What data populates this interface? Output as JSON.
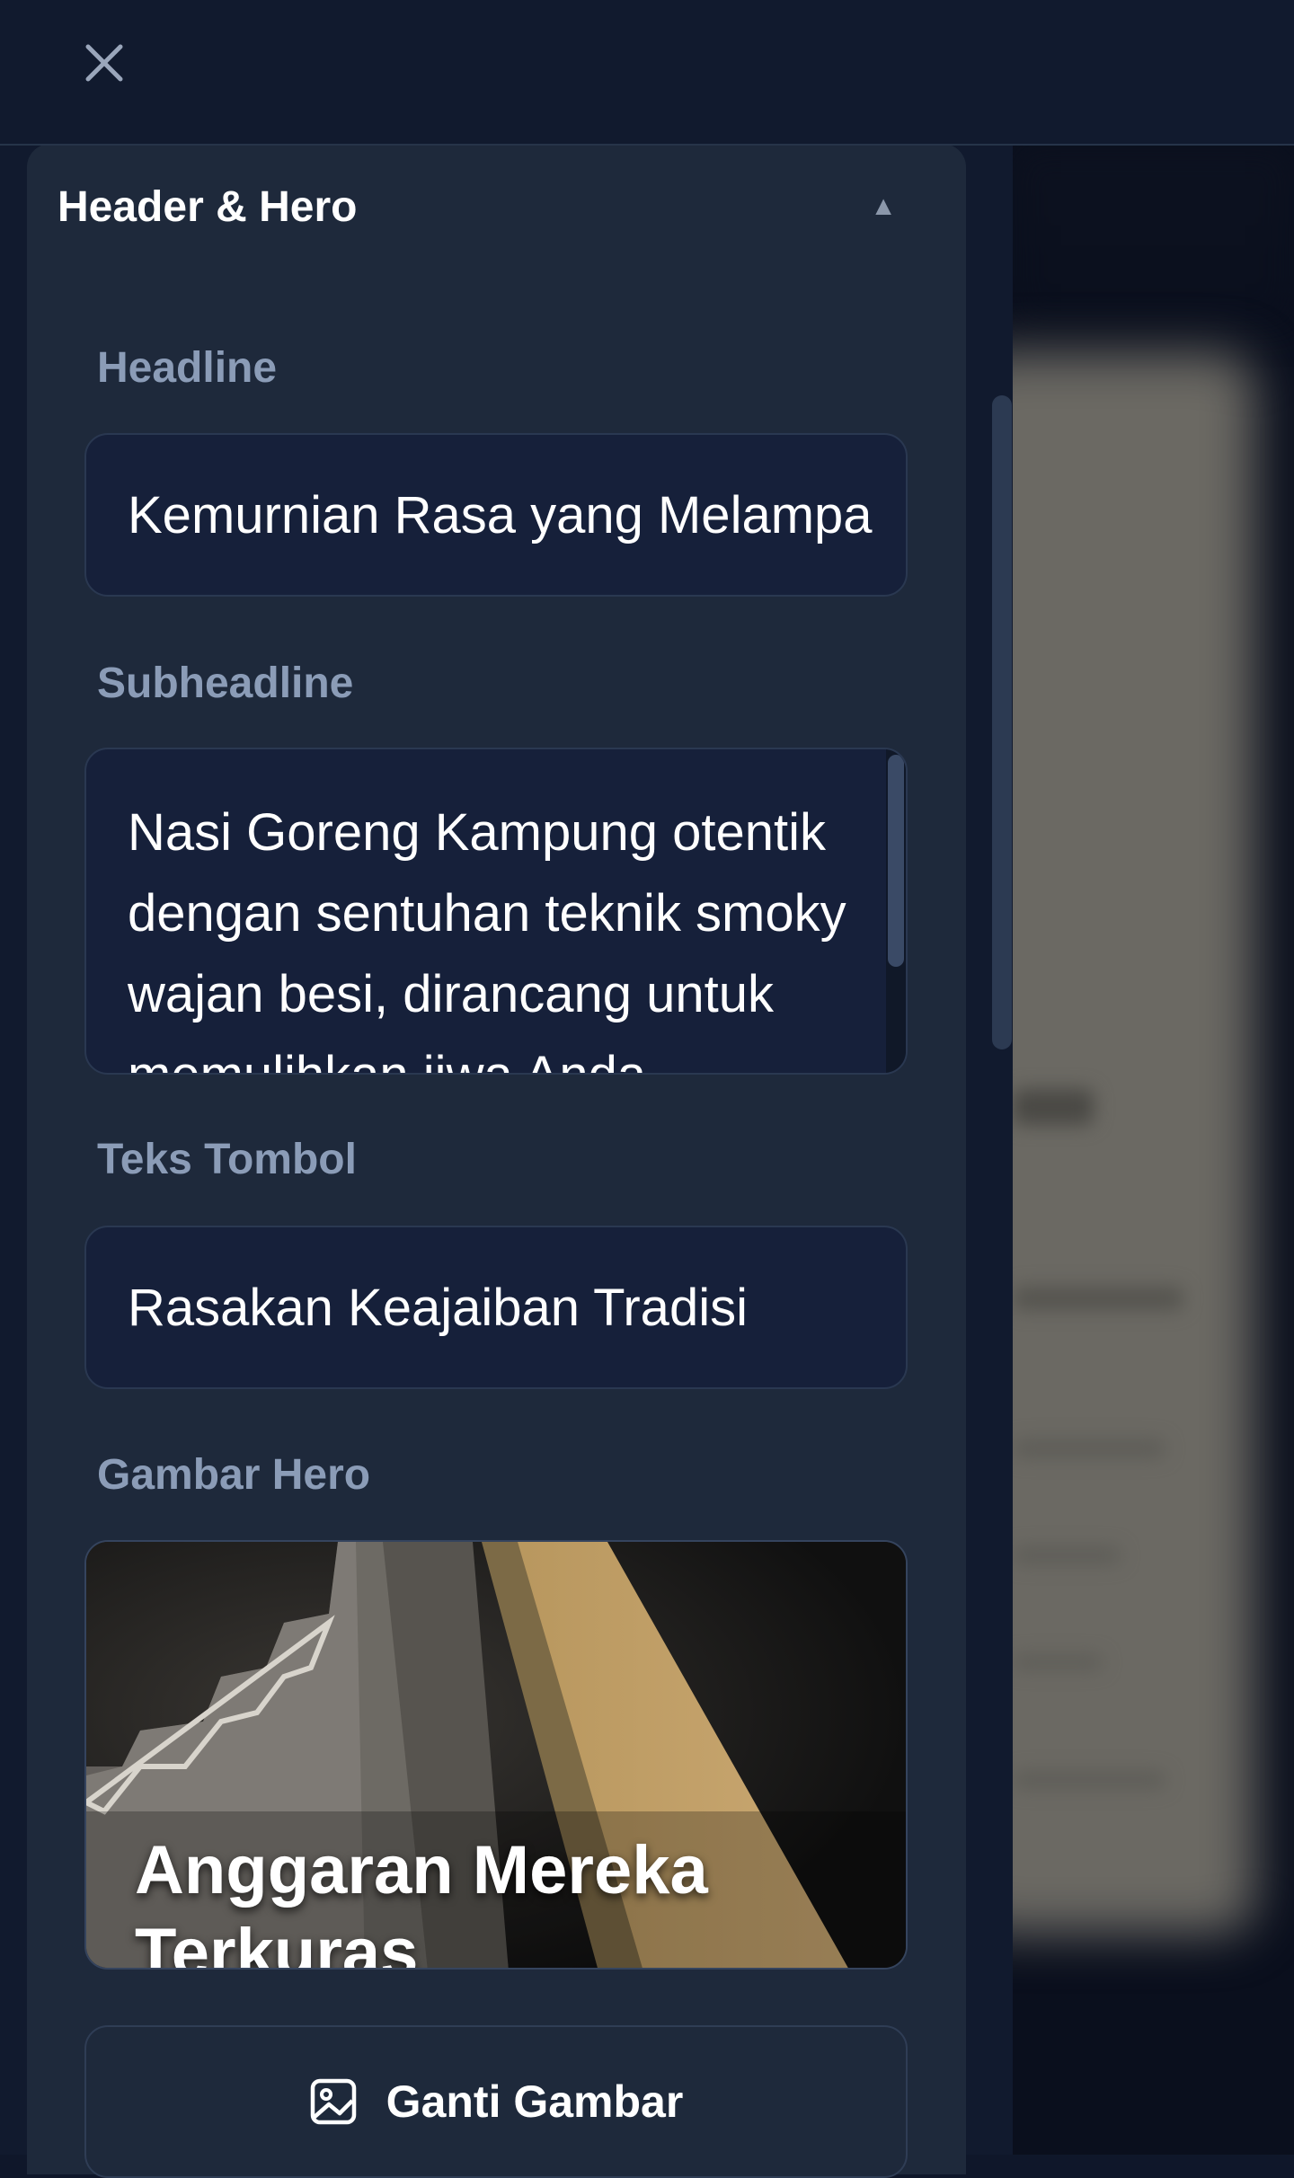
{
  "topbar": {
    "close_icon": "close-icon"
  },
  "section": {
    "title": "Header & Hero",
    "caret_icon": "caret-up-icon",
    "expanded": true
  },
  "fields": {
    "headline": {
      "label": "Headline",
      "value": "Kemurnian Rasa yang Melampa"
    },
    "subheadline": {
      "label": "Subheadline",
      "value": "Nasi Goreng Kampung otentik dengan sentuhan teknik smoky wajan besi, dirancang untuk memulihkan jiwa Anda"
    },
    "button_text": {
      "label": "Teks Tombol",
      "value": "Rasakan Keajaiban Tradisi"
    },
    "hero_image": {
      "label": "Gambar Hero",
      "caption": "Anggaran Mereka Terkuras"
    }
  },
  "actions": {
    "replace_image_label": "Ganti Gambar",
    "replace_image_icon": "image-icon"
  },
  "colors": {
    "background": "#0f172a",
    "panel": "#1e293b",
    "input": "#16203a",
    "label": "#8b9cb7",
    "accent_gold": "#c4a46a"
  }
}
